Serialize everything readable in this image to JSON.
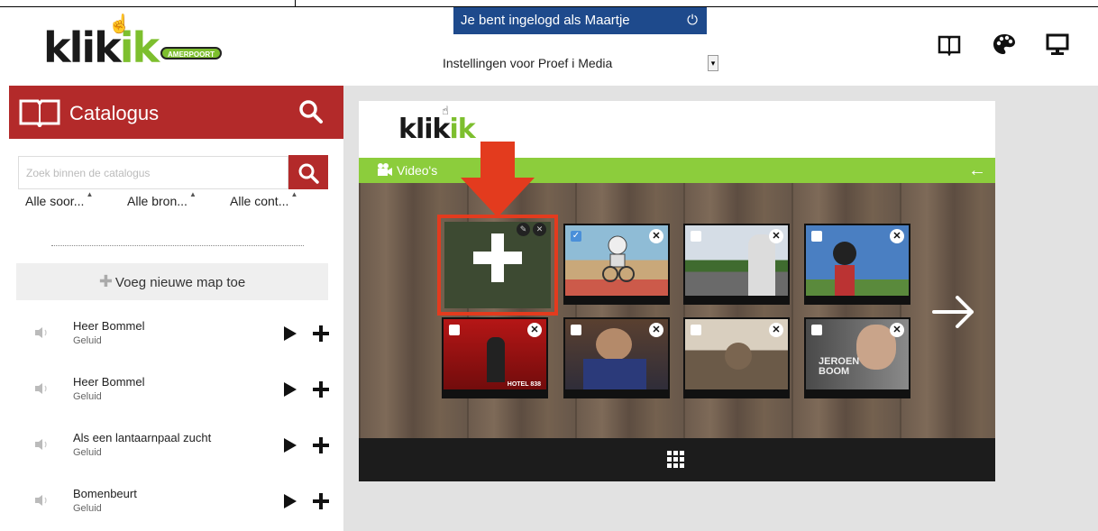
{
  "header": {
    "logo_text_a": "klik",
    "logo_text_b": "ik",
    "logo_badge": "AMERPOORT",
    "login_text": "Je bent ingelogd als Maartje",
    "power_icon": "power-icon",
    "settings_label": "Instellingen voor  Proef i Media",
    "icons": [
      "book-icon",
      "palette-icon",
      "monitor-icon"
    ]
  },
  "sidebar": {
    "title": "Catalogus",
    "search_placeholder": "Zoek binnen de catalogus",
    "filters": [
      "Alle soor...",
      "Alle bron...",
      "Alle cont..."
    ],
    "new_folder": "Voeg nieuwe map toe",
    "items": [
      {
        "name": "Heer Bommel",
        "type": "Geluid"
      },
      {
        "name": "Heer Bommel",
        "type": "Geluid"
      },
      {
        "name": "Als een lantaarnpaal zucht",
        "type": "Geluid"
      },
      {
        "name": "Bomenbeurt",
        "type": "Geluid"
      }
    ]
  },
  "main": {
    "logo_a": "klik",
    "logo_b": "ik",
    "section_label": "Video's",
    "thumbnails": [
      {
        "row": 1,
        "checked": true
      },
      {
        "row": 1,
        "checked": false
      },
      {
        "row": 1,
        "checked": false
      },
      {
        "row": 2,
        "checked": false,
        "caption": "HOTEL 838"
      },
      {
        "row": 2,
        "checked": false
      },
      {
        "row": 2,
        "checked": false
      },
      {
        "row": 2,
        "checked": false,
        "caption": "JEROEN BOOM"
      }
    ]
  },
  "colors": {
    "brand_red": "#b32a2a",
    "brand_green": "#8ccd3c",
    "login_blue": "#1e4a8c",
    "highlight": "#e33b1e"
  }
}
